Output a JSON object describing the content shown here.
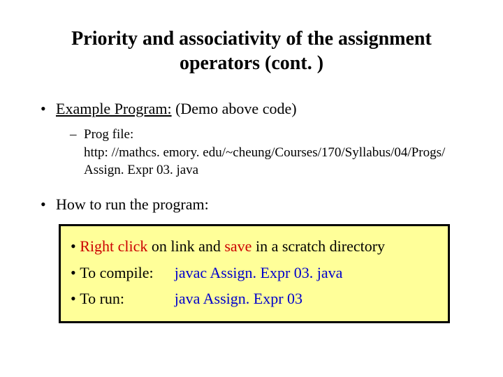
{
  "title": "Priority and associativity of the assignment operators (cont. )",
  "bullets": {
    "example_label": "Example Program:",
    "example_tail": " (Demo above code)",
    "progfile_label": "Prog file:",
    "progfile_url": "http: //mathcs. emory. edu/~cheung/Courses/170/Syllabus/04/Progs/ Assign. Expr 03. java",
    "howto": "How to run the program:"
  },
  "box": {
    "line1_a": "Right click",
    "line1_b": " on link and ",
    "line1_c": "save",
    "line1_d": " in a scratch directory",
    "compile_label": "To compile:",
    "compile_cmd": "javac Assign. Expr 03. java",
    "run_label": "To run:",
    "run_cmd": "java Assign. Expr 03"
  }
}
